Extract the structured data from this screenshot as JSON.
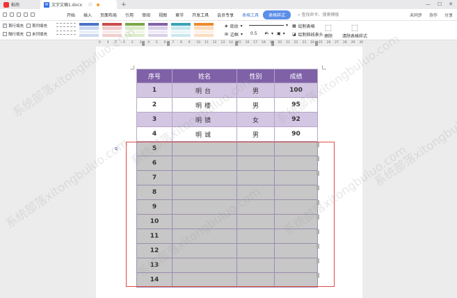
{
  "tabs": {
    "home_label": "稻壳",
    "doc_label": "文字文稿1.docx",
    "new_tab": "+"
  },
  "menu": {
    "items": [
      "开始",
      "插入",
      "页面布局",
      "引用",
      "审阅",
      "视图",
      "章节",
      "开发工具",
      "会员专享"
    ],
    "context_tool": "表格工具",
    "active_tab": "表格样式",
    "search": "查找命令、搜索模板",
    "right": [
      "未同步",
      "协作",
      "分享"
    ]
  },
  "ribbon": {
    "checks": [
      {
        "label": "首行填充",
        "checked": true
      },
      {
        "label": "首列填充",
        "checked": false
      },
      {
        "label": "隔行填充",
        "checked": false
      },
      {
        "label": "末列填充",
        "checked": false
      }
    ],
    "shading_label": "底纹",
    "border_label": "边框",
    "line_width": "0.5",
    "draw_table": "绘制表格",
    "draw_slash": "绘制斜线表头",
    "erase": "擦除",
    "clear_style": "清除表格样式"
  },
  "ruler": {
    "numbers": [
      "6",
      "4",
      "5",
      "1",
      "2",
      "3",
      "4",
      "5",
      "6",
      "7",
      "8",
      "9",
      "10",
      "11",
      "12",
      "13",
      "14",
      "15",
      "16",
      "17",
      "18",
      "19",
      "20",
      "21",
      "22",
      "23",
      "24",
      "25",
      "26",
      "27",
      "28",
      "29",
      "30"
    ]
  },
  "table": {
    "headers": [
      "序号",
      "姓名",
      "性别",
      "成绩"
    ],
    "rows": [
      [
        "1",
        "明台",
        "男",
        "100"
      ],
      [
        "2",
        "明楼",
        "男",
        "95"
      ],
      [
        "3",
        "明镜",
        "女",
        "92"
      ],
      [
        "4",
        "明诚",
        "男",
        "90"
      ]
    ],
    "empty_rows": [
      "5",
      "6",
      "7",
      "8",
      "9",
      "10",
      "11",
      "12",
      "13",
      "14"
    ]
  },
  "colors": {
    "header_bg": "#7f61a8",
    "band_bg": "#d3c6e3",
    "selected_bg": "#c7c7c7",
    "selection_outline": "#e04848",
    "active_tab_bg": "#5b8ee8"
  },
  "watermark": {
    "text": "系统部落xitongbuluo.com"
  }
}
